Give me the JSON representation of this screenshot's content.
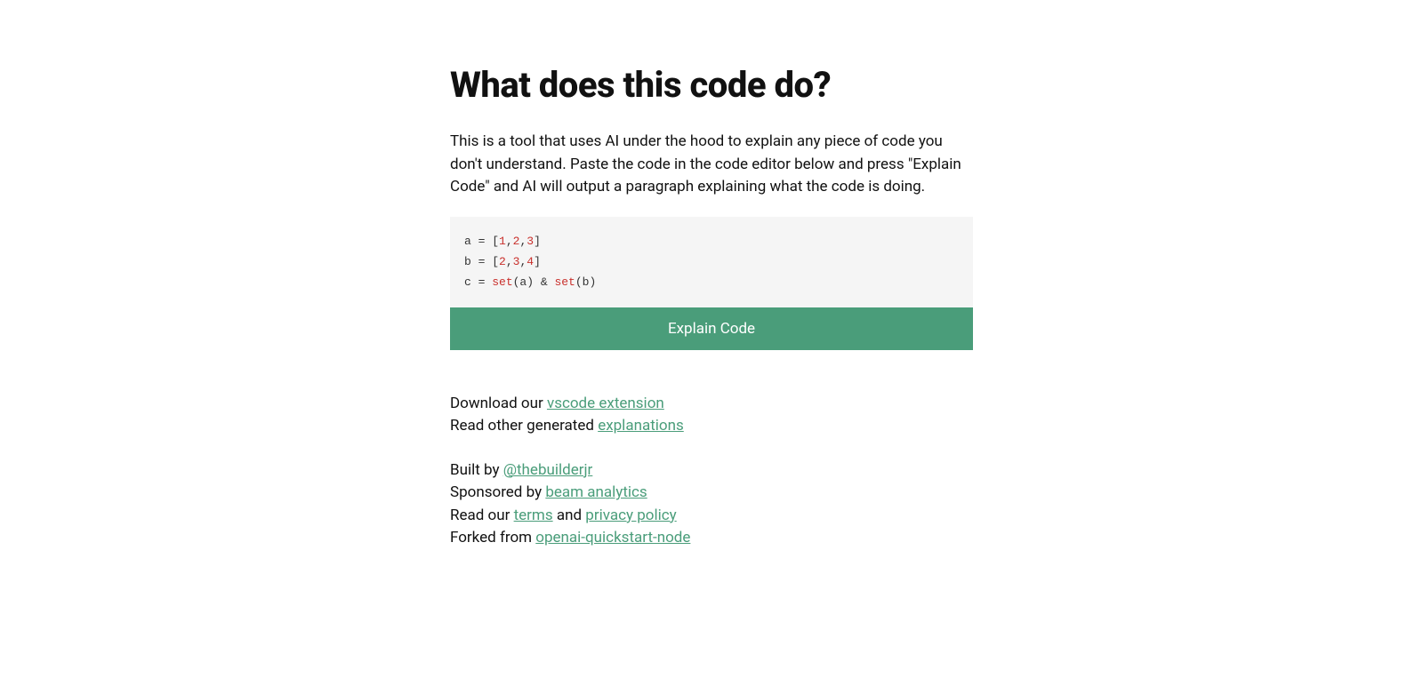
{
  "heading": "What does this code do?",
  "description": "This is a tool that uses AI under the hood to explain any piece of code you don't understand. Paste the code in the code editor below and press \"Explain Code\" and AI will output a paragraph explaining what the code is doing.",
  "code": {
    "line1_a": "a ",
    "line1_eq": "= ",
    "line1_open": "[",
    "line1_n1": "1",
    "line1_c1": ",",
    "line1_n2": "2",
    "line1_c2": ",",
    "line1_n3": "3",
    "line1_close": "]",
    "line2_a": "b ",
    "line2_eq": "= ",
    "line2_open": "[",
    "line2_n1": "2",
    "line2_c1": ",",
    "line2_n2": "3",
    "line2_c2": ",",
    "line2_n3": "4",
    "line2_close": "]",
    "line3_a": "c ",
    "line3_eq": "= ",
    "line3_set1": "set",
    "line3_p1": "(a) ",
    "line3_amp": "& ",
    "line3_set2": "set",
    "line3_p2": "(b)"
  },
  "button": "Explain Code",
  "links": {
    "download_prefix": "Download our ",
    "vscode_ext": "vscode extension",
    "read_prefix": "Read other generated ",
    "explanations": "explanations",
    "built_prefix": "Built by ",
    "builder": "@thebuilderjr",
    "sponsored_prefix": "Sponsored by ",
    "beam": "beam analytics",
    "read_our": "Read our ",
    "terms": "terms",
    "and": " and ",
    "privacy": "privacy policy",
    "forked_prefix": "Forked from ",
    "openai": "openai-quickstart-node"
  }
}
